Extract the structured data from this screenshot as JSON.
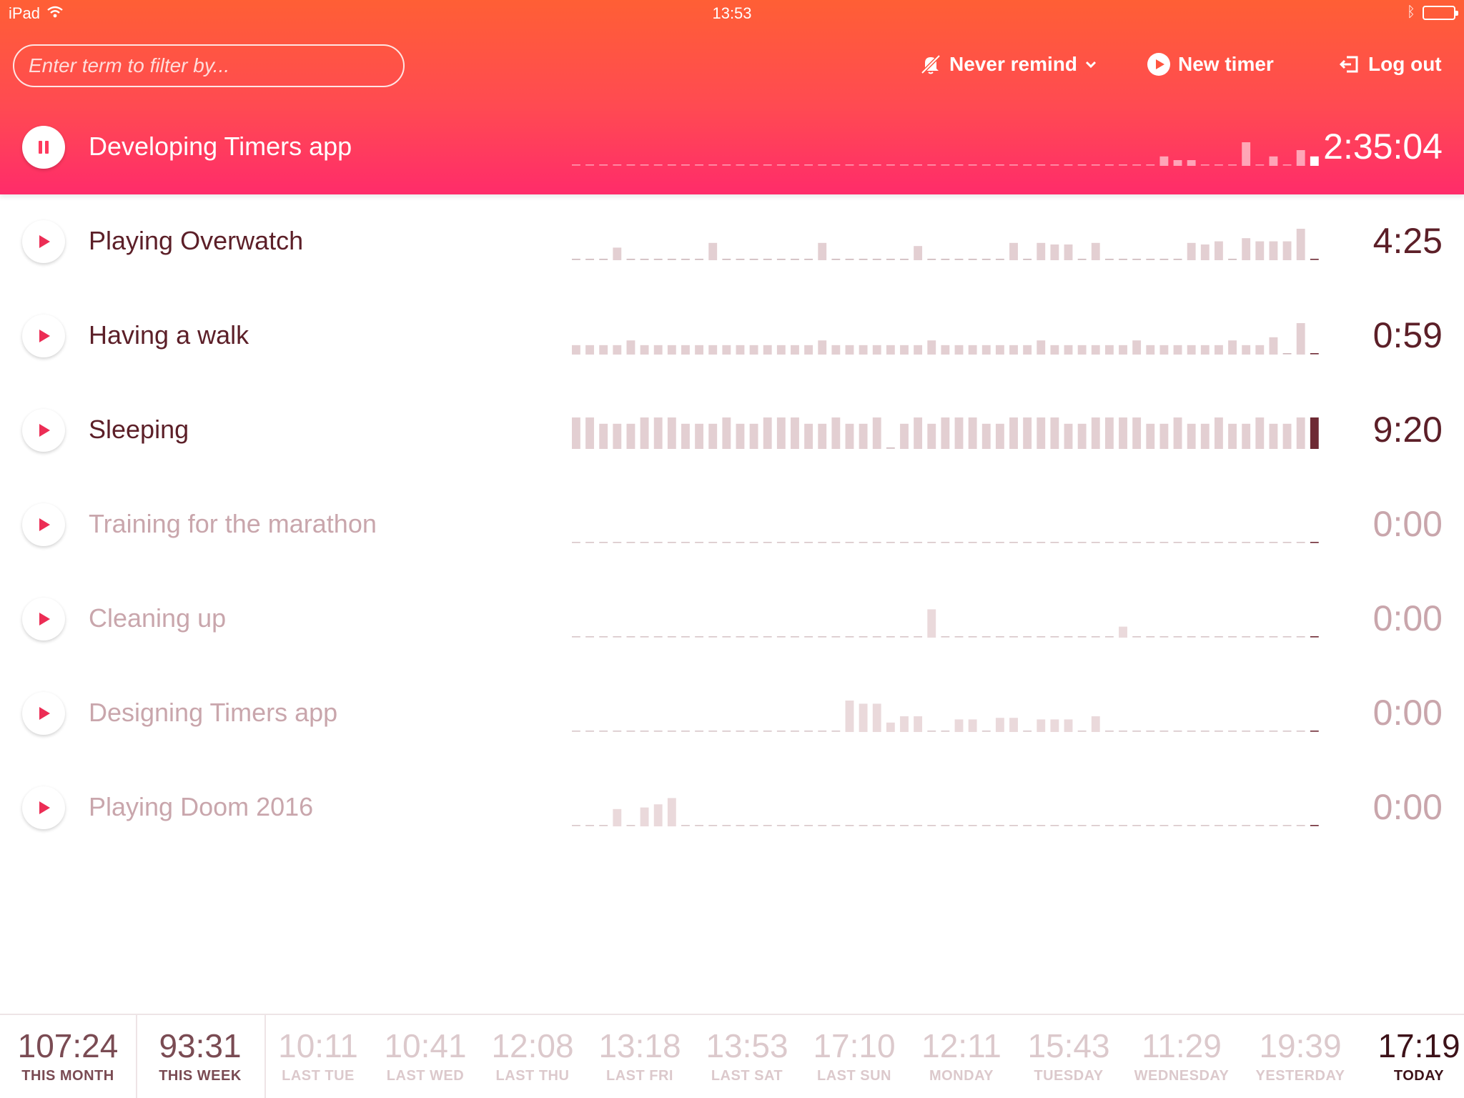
{
  "status_bar": {
    "device": "iPad",
    "time": "13:53"
  },
  "header": {
    "filter_placeholder": "Enter term to filter by...",
    "remind_label": "Never remind",
    "new_timer_label": "New timer",
    "logout_label": "Log out"
  },
  "active_timer": {
    "name": "Developing Timers app",
    "time": "2:35:04",
    "history": [
      0,
      0,
      0,
      0,
      0,
      0,
      0,
      0,
      0,
      0,
      0,
      0,
      0,
      0,
      0,
      0,
      0,
      0,
      0,
      0,
      0,
      0,
      0,
      0,
      0,
      0,
      0,
      0,
      0,
      0,
      0,
      0,
      0,
      0,
      0,
      0,
      0,
      0,
      0,
      0,
      0,
      0,
      0,
      0.3,
      0.15,
      0.15,
      0,
      0,
      0,
      0.75,
      0,
      0.3,
      0,
      0.5,
      0.3
    ]
  },
  "timers": [
    {
      "name": "Playing Overwatch",
      "time": "4:25",
      "state": "dark",
      "history": [
        0,
        0,
        0,
        0.4,
        0,
        0,
        0,
        0,
        0,
        0,
        0.55,
        0,
        0,
        0,
        0,
        0,
        0,
        0,
        0.55,
        0,
        0,
        0,
        0,
        0,
        0,
        0.45,
        0,
        0,
        0,
        0,
        0,
        0,
        0.55,
        0,
        0.55,
        0.5,
        0.5,
        0,
        0.55,
        0,
        0,
        0,
        0,
        0,
        0,
        0.55,
        0.5,
        0.6,
        0,
        0.7,
        0.6,
        0.6,
        0.6,
        1.0,
        0
      ]
    },
    {
      "name": "Having a walk",
      "time": "0:59",
      "state": "dark",
      "history": [
        0.3,
        0.3,
        0.3,
        0.3,
        0.45,
        0.3,
        0.3,
        0.3,
        0.3,
        0.3,
        0.3,
        0.3,
        0.3,
        0.3,
        0.3,
        0.3,
        0.3,
        0.3,
        0.45,
        0.3,
        0.3,
        0.3,
        0.3,
        0.3,
        0.3,
        0.3,
        0.45,
        0.3,
        0.3,
        0.3,
        0.3,
        0.3,
        0.3,
        0.3,
        0.45,
        0.3,
        0.3,
        0.3,
        0.3,
        0.3,
        0.3,
        0.45,
        0.3,
        0.3,
        0.3,
        0.3,
        0.3,
        0.3,
        0.45,
        0.3,
        0.3,
        0.55,
        0,
        1.0,
        0
      ]
    },
    {
      "name": "Sleeping",
      "time": "9:20",
      "state": "dark",
      "history": [
        1,
        1,
        0.8,
        0.8,
        0.8,
        1,
        1,
        1,
        0.8,
        0.8,
        0.8,
        1,
        0.8,
        0.8,
        1,
        1,
        1,
        0.8,
        0.8,
        1,
        0.8,
        0.8,
        1,
        0,
        0.8,
        1,
        0.8,
        1,
        1,
        1,
        0.8,
        0.8,
        1,
        1,
        1,
        1,
        0.8,
        0.8,
        1,
        1,
        1,
        1,
        0.8,
        0.8,
        1,
        0.8,
        0.8,
        1,
        0.8,
        0.8,
        1,
        0.8,
        0.8,
        1,
        1
      ]
    },
    {
      "name": "Training for the marathon",
      "time": "0:00",
      "state": "inactive",
      "history": [
        0,
        0,
        0,
        0,
        0,
        0,
        0,
        0,
        0,
        0,
        0,
        0,
        0,
        0,
        0,
        0,
        0,
        0,
        0,
        0,
        0,
        0,
        0,
        0,
        0,
        0,
        0,
        0,
        0,
        0,
        0,
        0,
        0,
        0,
        0,
        0,
        0,
        0,
        0,
        0,
        0,
        0,
        0,
        0,
        0,
        0,
        0,
        0,
        0,
        0,
        0,
        0,
        0,
        0,
        0
      ]
    },
    {
      "name": "Cleaning up",
      "time": "0:00",
      "state": "inactive",
      "history": [
        0,
        0,
        0,
        0,
        0,
        0,
        0,
        0,
        0,
        0,
        0,
        0,
        0,
        0,
        0,
        0,
        0,
        0,
        0,
        0,
        0,
        0,
        0,
        0,
        0,
        0,
        0.9,
        0,
        0,
        0,
        0,
        0,
        0,
        0,
        0,
        0,
        0,
        0,
        0,
        0,
        0.35,
        0,
        0,
        0,
        0,
        0,
        0,
        0,
        0,
        0,
        0,
        0,
        0,
        0,
        0
      ]
    },
    {
      "name": "Designing Timers app",
      "time": "0:00",
      "state": "inactive",
      "history": [
        0,
        0,
        0,
        0,
        0,
        0,
        0,
        0,
        0,
        0,
        0,
        0,
        0,
        0,
        0,
        0,
        0,
        0,
        0,
        0,
        1,
        0.9,
        0.9,
        0.3,
        0.5,
        0.5,
        0,
        0,
        0.4,
        0.4,
        0,
        0.45,
        0.45,
        0,
        0.4,
        0.4,
        0.4,
        0,
        0.5,
        0,
        0,
        0,
        0,
        0,
        0,
        0,
        0,
        0,
        0,
        0,
        0,
        0,
        0,
        0,
        0
      ]
    },
    {
      "name": "Playing Doom 2016",
      "time": "0:00",
      "state": "inactive",
      "history": [
        0,
        0,
        0,
        0.55,
        0,
        0.6,
        0.7,
        0.9,
        0,
        0,
        0,
        0,
        0,
        0,
        0,
        0,
        0,
        0,
        0,
        0,
        0,
        0,
        0,
        0,
        0,
        0,
        0,
        0,
        0,
        0,
        0,
        0,
        0,
        0,
        0,
        0,
        0,
        0,
        0,
        0,
        0,
        0,
        0,
        0,
        0,
        0,
        0,
        0,
        0,
        0,
        0,
        0,
        0,
        0,
        0
      ]
    }
  ],
  "footer": [
    {
      "value": "107:24",
      "label": "THIS MONTH",
      "style": "strong"
    },
    {
      "value": "93:31",
      "label": "THIS WEEK",
      "style": "strong"
    },
    {
      "value": "10:11",
      "label": "LAST TUE",
      "style": "faint"
    },
    {
      "value": "10:41",
      "label": "LAST WED",
      "style": "faint"
    },
    {
      "value": "12:08",
      "label": "LAST THU",
      "style": "faint"
    },
    {
      "value": "13:18",
      "label": "LAST FRI",
      "style": "faint"
    },
    {
      "value": "13:53",
      "label": "LAST SAT",
      "style": "faint"
    },
    {
      "value": "17:10",
      "label": "LAST SUN",
      "style": "faint"
    },
    {
      "value": "12:11",
      "label": "MONDAY",
      "style": "faint"
    },
    {
      "value": "15:43",
      "label": "TUESDAY",
      "style": "faint"
    },
    {
      "value": "11:29",
      "label": "WEDNESDAY",
      "style": "faint"
    },
    {
      "value": "19:39",
      "label": "YESTERDAY",
      "style": "faint"
    },
    {
      "value": "17:19",
      "label": "TODAY",
      "style": "today"
    }
  ],
  "colors": {
    "header_top": "#ff5f35",
    "header_bottom": "#ff2c6a",
    "play_red": "#ec2d55",
    "text_dark": "#5c1f28",
    "text_inactive": "#c9a6ac"
  },
  "icons": {
    "pause": "pause-icon",
    "play": "play-icon",
    "remind": "bell-off-icon",
    "new_timer": "play-circle-icon",
    "logout": "logout-icon",
    "wifi": "wifi-icon",
    "battery": "battery-icon"
  }
}
